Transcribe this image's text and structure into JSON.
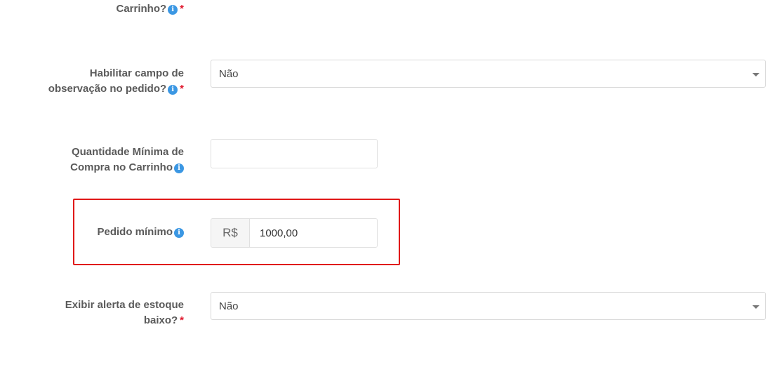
{
  "fields": {
    "carrinho_partial": {
      "label": "Carrinho?",
      "required_mark": "*",
      "info_icon": "info-icon"
    },
    "observacao": {
      "label_line1": "Habilitar campo de",
      "label_line2": "observação no pedido?",
      "required_mark": "*",
      "value": "Não"
    },
    "quantidade_minima": {
      "label_line1": "Quantidade Mínima de",
      "label_line2": "Compra no Carrinho",
      "value": ""
    },
    "pedido_minimo": {
      "label": "Pedido mínimo",
      "currency": "R$",
      "value": "1000,00"
    },
    "alerta_estoque": {
      "label_line1": "Exibir alerta de estoque",
      "label_line2": "baixo?",
      "required_mark": "*",
      "value": "Não"
    }
  },
  "icons": {
    "info": "i"
  },
  "colors": {
    "info": "#3b97e3",
    "required": "#e0182d",
    "highlight": "#e01818"
  }
}
